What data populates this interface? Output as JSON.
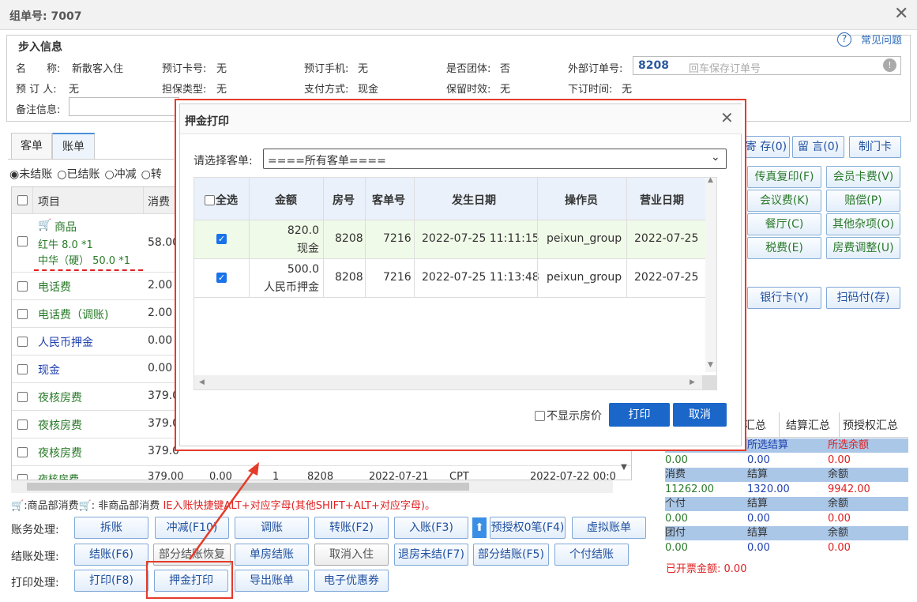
{
  "window": {
    "title": "组单号: 7007"
  },
  "step": {
    "legend": "步入信息",
    "fields": [
      {
        "label": "名　　称:",
        "value": "新散客入住"
      },
      {
        "label": "预订卡号:",
        "value": "无"
      },
      {
        "label": "预订手机:",
        "value": "无"
      },
      {
        "label": "是否团体:",
        "value": "否"
      },
      {
        "label": "预 订 人:",
        "value": "无"
      },
      {
        "label": "担保类型:",
        "value": "无"
      },
      {
        "label": "支付方式:",
        "value": "现金"
      },
      {
        "label": "保留时效:",
        "value": "无"
      },
      {
        "label": "下订时间:",
        "value": "无"
      }
    ],
    "external_label": "外部订单号:",
    "external_room": "8208",
    "external_placeholder": "回车保存订单号",
    "remark_label": "备注信息:"
  },
  "help": {
    "icon": "question-icon",
    "label": "常见问题"
  },
  "tabs": [
    "客单",
    "账单"
  ],
  "filters": [
    "未结账",
    "已结账",
    "冲减",
    "转"
  ],
  "grid": {
    "headers": [
      "项目",
      "消费"
    ],
    "rows": [
      {
        "name": "商品",
        "lines": [
          "红牛 8.0 *1",
          "中华（硬） 50.0 *1"
        ],
        "amt": "58.00"
      },
      {
        "name": "电话费",
        "amt": "2.00"
      },
      {
        "name": "电话费（调账)",
        "amt": "2.00"
      },
      {
        "name": "人民币押金",
        "amt": "0.00"
      },
      {
        "name": "现金",
        "amt": "0.00"
      },
      {
        "name": "夜核房费",
        "amt": "379.0"
      },
      {
        "name": "夜核房费",
        "amt": "379.0"
      },
      {
        "name": "夜核房费",
        "amt": "379.0"
      },
      {
        "name": "夜核房费",
        "amt": "379.00",
        "c3": "0.00",
        "c4": "1",
        "c5": "8208",
        "c6": "2022-07-21",
        "c7": "CPT",
        "c8": "2022-07-22 00:0"
      }
    ]
  },
  "legendline": {
    "a": "商品部消费",
    "b": "非商品部消费",
    "hint": "IE入账快捷键ALT+对应字母(其他SHIFT+ALT+对应字母)。"
  },
  "right_buttons": [
    [
      "寄 存(0)",
      "留 言(0)",
      "制门卡"
    ],
    [
      "传真复印(F)",
      "会员卡费(V)"
    ],
    [
      "会议费(K)",
      "赔偿(P)"
    ],
    [
      "餐厅(C)",
      "其他杂项(O)"
    ],
    [
      "税费(E)",
      "房费调整(U)"
    ],
    [
      "银行卡(Y)",
      "扫码付(存)"
    ]
  ],
  "summary": {
    "tabs": [
      "汇总",
      "结算汇总",
      "预授权汇总"
    ],
    "blocks": [
      {
        "h": [
          "",
          "所选结算",
          "所选余额"
        ],
        "v": [
          "0.00",
          "0.00",
          "0.00"
        ]
      },
      {
        "h": [
          "消费",
          "结算",
          "余额"
        ],
        "v": [
          "11262.00",
          "1320.00",
          "9942.00"
        ]
      },
      {
        "h": [
          "个付",
          "结算",
          "余额"
        ],
        "v": [
          "0.00",
          "0.00",
          "0.00"
        ]
      },
      {
        "h": [
          "团付",
          "结算",
          "余额"
        ],
        "v": [
          "0.00",
          "0.00",
          "0.00"
        ]
      }
    ],
    "invoiced_label": "已开票金额:",
    "invoiced": "0.00"
  },
  "actions": {
    "row1_label": "账务处理:",
    "row1": [
      "拆账",
      "冲减(F10)",
      "调账",
      "转账(F2)",
      "入账(F3)",
      "预授权0笔(F4)",
      "虚拟账单"
    ],
    "row2_label": "结账处理:",
    "row2": [
      "结账(F6)",
      "部分结账恢复",
      "单房结账",
      "取消入住",
      "退房未结(F7)",
      "部分结账(F5)",
      "个付结账"
    ],
    "row3_label": "打印处理:",
    "row3": [
      "打印(F8)",
      "押金打印",
      "导出账单",
      "电子优惠券"
    ]
  },
  "dialog": {
    "title": "押金打印",
    "select_label": "请选择客单:",
    "select_value": "====所有客单====",
    "headers": [
      "全选",
      "金额",
      "房号",
      "客单号",
      "发生日期",
      "操作员",
      "营业日期"
    ],
    "rows": [
      {
        "amt": "820.0",
        "type": "现金",
        "room": "8208",
        "order": "7216",
        "date": "2022-07-25 11:11:15",
        "op": "peixun_group",
        "bday": "2022-07-25"
      },
      {
        "amt": "500.0",
        "type": "人民币押金",
        "room": "8208",
        "order": "7216",
        "date": "2022-07-25 11:13:48",
        "op": "peixun_group",
        "bday": "2022-07-25"
      }
    ],
    "hide_price": "不显示房价",
    "print": "打印",
    "cancel": "取消"
  },
  "colors": {
    "accent": "#1a66c9",
    "highlight": "#e53b2a",
    "green": "#2a7a2a"
  }
}
